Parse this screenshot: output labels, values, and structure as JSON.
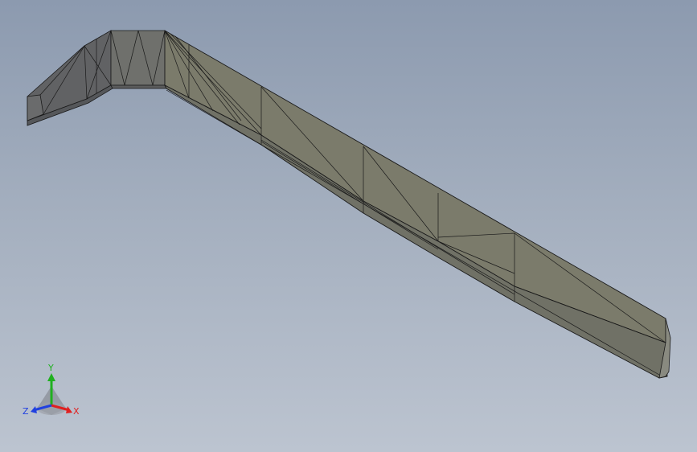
{
  "viewport": {
    "name": "graphics-area",
    "background_top": "#8c9aaf",
    "background_bottom": "#bcc4d0"
  },
  "model": {
    "name": "swept-profile-part",
    "face_color": "#7c7c6c",
    "face_color_dark": "#5f6061",
    "face_color_mid": "#6f6f6a",
    "edge_color": "#1a1a1a"
  },
  "triad": {
    "x_label": "X",
    "y_label": "Y",
    "z_label": "Z",
    "x_color": "#e02020",
    "y_color": "#20b020",
    "z_color": "#2040e0"
  }
}
